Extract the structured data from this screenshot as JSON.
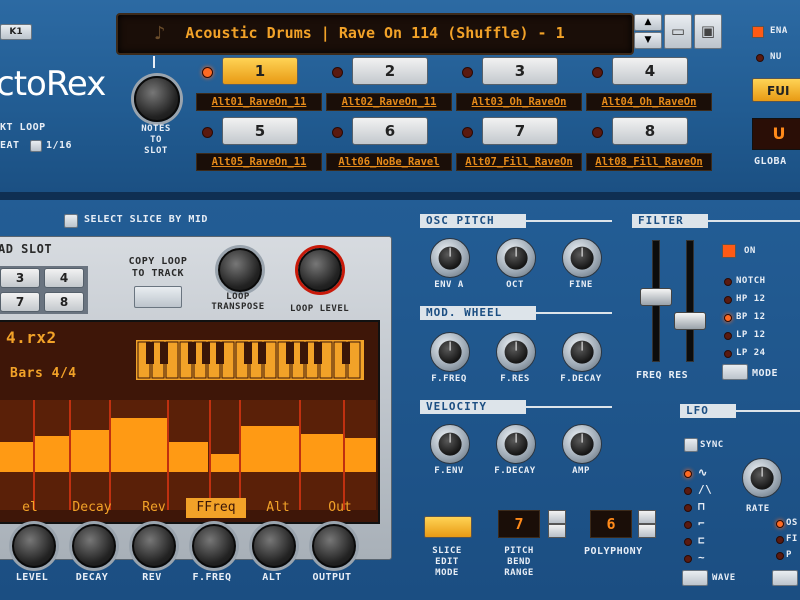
{
  "top": {
    "logo": "ctoRex",
    "logo_tag": "K1",
    "preset_name": "Acoustic Drums | Rave On  114 (Shuffle) - 1",
    "notes_to_slot": "NOTES\nTO\nSLOT",
    "loop_label": "KT LOOP",
    "repeat_label": "EAT",
    "repeat_value": "1/16",
    "enable_label": "ENA",
    "nud_label": "NU",
    "fun_label": "FUI",
    "u_label": "U",
    "global_label": "GLOBA",
    "slots": [
      {
        "num": "1",
        "file": "Alt01_RaveOn_11",
        "active": true
      },
      {
        "num": "2",
        "file": "Alt02_RaveOn_11",
        "active": false
      },
      {
        "num": "3",
        "file": "Alt03_Oh_RaveOn",
        "active": false
      },
      {
        "num": "4",
        "file": "Alt04_Oh_RaveOn",
        "active": false
      },
      {
        "num": "5",
        "file": "Alt05_RaveOn_11",
        "active": false
      },
      {
        "num": "6",
        "file": "Alt06_NoBe_Ravel",
        "active": false
      },
      {
        "num": "7",
        "file": "Alt07_Fill_RaveOn",
        "active": false
      },
      {
        "num": "8",
        "file": "Alt08_Fill_RaveOn",
        "active": false
      }
    ]
  },
  "player": {
    "select_slice_label": "SELECT SLICE BY MID",
    "load_slot_label": "AD SLOT",
    "load_slots": [
      "3",
      "4",
      "7",
      "8"
    ],
    "copy_loop_label": "COPY LOOP\nTO TRACK",
    "loop_transpose_label": "LOOP\nTRANSPOSE",
    "loop_level_label": "LOOP LEVEL",
    "filename": "4.rx2",
    "bars": "Bars 4/4",
    "param_tabs": [
      "el",
      "Decay",
      "Rev",
      "FFreq",
      "Alt",
      "Out"
    ],
    "active_tab": "FFreq",
    "bottom_knobs": [
      "LEVEL",
      "DECAY",
      "REV",
      "F.FREQ",
      "ALT",
      "OUTPUT"
    ]
  },
  "osc_pitch": {
    "title": "OSC PITCH",
    "knobs": [
      "ENV A",
      "OCT",
      "FINE"
    ]
  },
  "mod_wheel": {
    "title": "MOD. WHEEL",
    "knobs": [
      "F.FREQ",
      "F.RES",
      "F.DECAY"
    ]
  },
  "velocity": {
    "title": "VELOCITY",
    "knobs": [
      "F.ENV",
      "F.DECAY",
      "AMP"
    ]
  },
  "filter": {
    "title": "FILTER",
    "on_label": "ON",
    "modes": [
      "NOTCH",
      "HP 12",
      "BP 12",
      "LP 12",
      "LP 24"
    ],
    "active_mode": "BP 12",
    "freq_res_label": "FREQ RES",
    "mode_label": "MODE"
  },
  "lfo": {
    "title": "LFO",
    "sync_label": "SYNC",
    "rate_label": "RATE",
    "wave_label": "WAVE",
    "right_labels": [
      "OS",
      "FI",
      "P"
    ]
  },
  "slice_edit": {
    "slice_edit_label": "SLICE\nEDIT\nMODE",
    "pitch_bend_label": "PITCH\nBEND\nRANGE",
    "pitch_bend_value": "7",
    "polyphony_label": "POLYPHONY",
    "polyphony_value": "6"
  },
  "colors": {
    "panel_blue": "#215b91",
    "display_orange": "#f2a228",
    "waveform_orange": "#ff9a14",
    "led_red": "#ff6a22"
  }
}
